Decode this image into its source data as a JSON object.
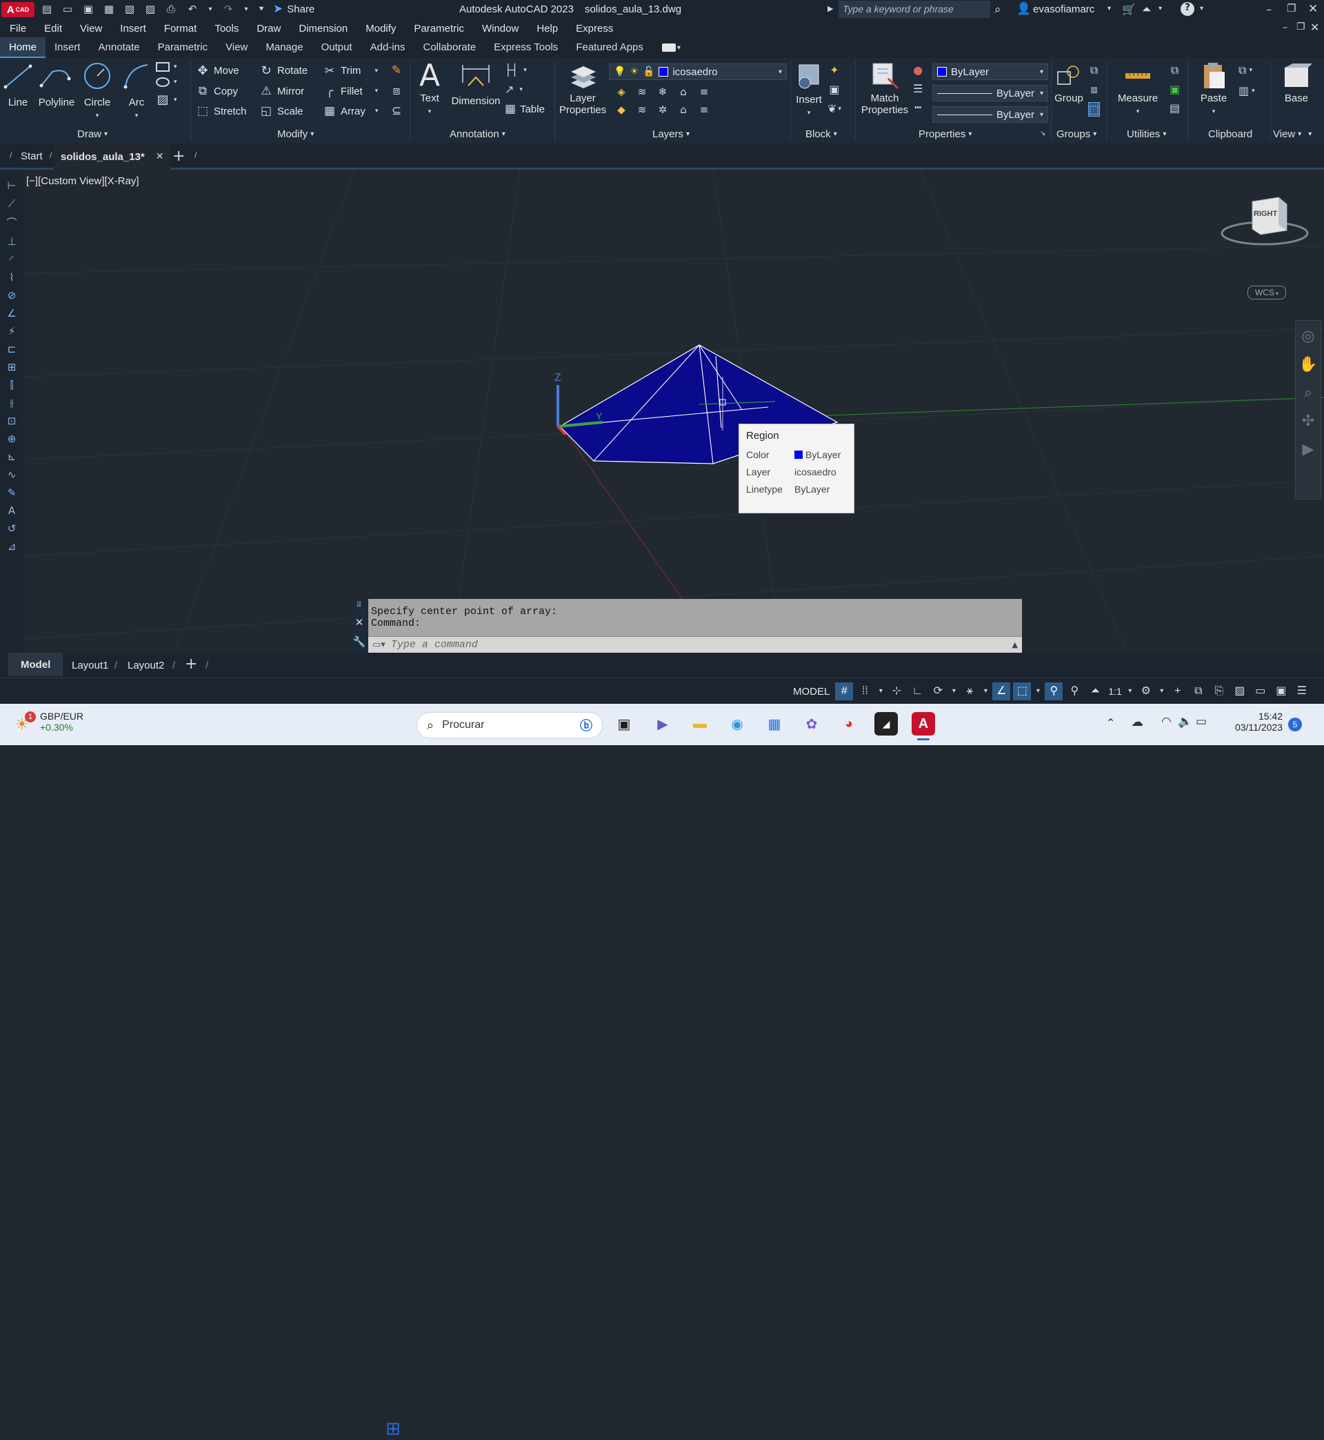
{
  "title_bar": {
    "app_badge": "CAD",
    "share_label": "Share",
    "title": "Autodesk AutoCAD 2023",
    "file_name": "solidos_aula_13.dwg",
    "search_placeholder": "Type a keyword or phrase",
    "username": "evasofiamarc"
  },
  "menu": [
    "File",
    "Edit",
    "View",
    "Insert",
    "Format",
    "Tools",
    "Draw",
    "Dimension",
    "Modify",
    "Parametric",
    "Window",
    "Help",
    "Express"
  ],
  "ribbon_tabs": [
    "Home",
    "Insert",
    "Annotate",
    "Parametric",
    "View",
    "Manage",
    "Output",
    "Add-ins",
    "Collaborate",
    "Express Tools",
    "Featured Apps"
  ],
  "ribbon": {
    "draw": {
      "line": "Line",
      "polyline": "Polyline",
      "circle": "Circle",
      "arc": "Arc",
      "title": "Draw"
    },
    "modify": {
      "move": "Move",
      "rotate": "Rotate",
      "trim": "Trim",
      "copy": "Copy",
      "mirror": "Mirror",
      "fillet": "Fillet",
      "stretch": "Stretch",
      "scale": "Scale",
      "array": "Array",
      "title": "Modify"
    },
    "annotation": {
      "text": "Text",
      "dimension": "Dimension",
      "table": "Table",
      "title": "Annotation"
    },
    "layers": {
      "layer_props_1": "Layer",
      "layer_props_2": "Properties",
      "current_layer": "icosaedro",
      "title": "Layers"
    },
    "block": {
      "insert": "Insert",
      "title": "Block"
    },
    "properties": {
      "match_1": "Match",
      "match_2": "Properties",
      "color": "ByLayer",
      "lineweight": "ByLayer",
      "linetype": "ByLayer",
      "title": "Properties"
    },
    "groups": {
      "group": "Group",
      "title": "Groups"
    },
    "utilities": {
      "measure": "Measure",
      "title": "Utilities"
    },
    "clipboard": {
      "paste": "Paste",
      "title": "Clipboard"
    },
    "view": {
      "base": "Base",
      "title": "View"
    }
  },
  "doc_tabs": {
    "start": "Start",
    "active": "solidos_aula_13*"
  },
  "viewport": {
    "label": "[−][Custom View][X-Ray]",
    "viewcube": "RIGHT",
    "wcs": "WCS",
    "axis_z": "Z",
    "axis_y": "Y",
    "shape_fill": "#0a0a8c"
  },
  "tooltip": {
    "title": "Region",
    "rows": [
      {
        "key": "Color",
        "value": "ByLayer"
      },
      {
        "key": "Layer",
        "value": "icosaedro"
      },
      {
        "key": "Linetype",
        "value": "ByLayer"
      }
    ],
    "swatch": "#0000ff"
  },
  "command": {
    "line1": "Specify center point of array:",
    "line2": "Command:",
    "placeholder": "Type a command"
  },
  "layout_tabs": [
    "Model",
    "Layout1",
    "Layout2"
  ],
  "status": {
    "model": "MODEL",
    "scale": "1:1"
  },
  "taskbar": {
    "widget_badge": "1",
    "widget_title": "GBP/EUR",
    "widget_value": "+0.30%",
    "search": "Procurar",
    "time": "15:42",
    "date": "03/11/2023",
    "notif": "5"
  }
}
